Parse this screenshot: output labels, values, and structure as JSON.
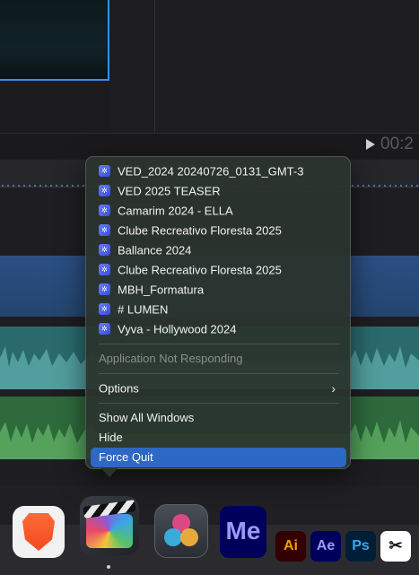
{
  "timeline": {
    "timecode": "00:2"
  },
  "context_menu": {
    "windows": [
      {
        "label": "VED_2024 20240726_0131_GMT-3"
      },
      {
        "label": "VED 2025 TEASER"
      },
      {
        "label": "Camarim 2024 - ELLA"
      },
      {
        "label": "Clube Recreativo Floresta 2025"
      },
      {
        "label": "Ballance 2024"
      },
      {
        "label": "Clube Recreativo Floresta 2025"
      },
      {
        "label": "MBH_Formatura"
      },
      {
        "label": "# LUMEN"
      },
      {
        "label": "Vyva - Hollywood 2024"
      }
    ],
    "status": "Application Not Responding",
    "options_label": "Options",
    "show_all_windows": "Show All Windows",
    "hide": "Hide",
    "force_quit": "Force Quit"
  },
  "dock": {
    "me_text": "Me",
    "ai_text": "Ai",
    "ae_text": "Ae",
    "ps_text": "Ps",
    "capcut_text": "✂"
  },
  "colors": {
    "selection": "#2c68c4",
    "menu_background": "#2a342e",
    "window_icon": "#5563f0"
  }
}
